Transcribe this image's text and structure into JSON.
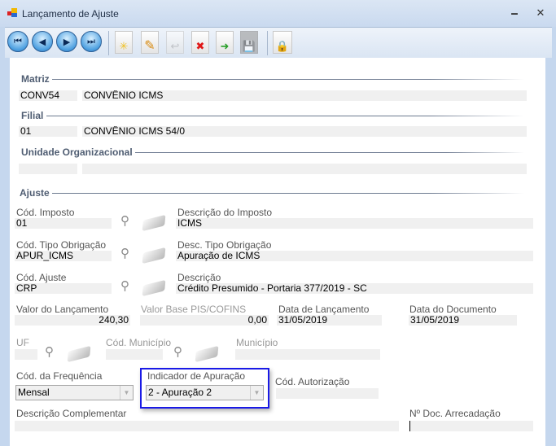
{
  "window": {
    "title": "Lançamento de Ajuste",
    "minimize": "🗕",
    "close": "✕"
  },
  "toolbar": {
    "first": "⏮",
    "prev": "◀",
    "next": "▶",
    "last": "⏭",
    "new": "✳",
    "edit": "✎",
    "undo": "↩",
    "delete": "✖",
    "export": "➜",
    "save": "💾",
    "lock": "🔒"
  },
  "matriz": {
    "heading": "Matriz",
    "code": "CONV54",
    "name": "CONVÊNIO ICMS"
  },
  "filial": {
    "heading": "Filial",
    "code": "01",
    "name": "CONVÊNIO ICMS 54/0"
  },
  "unidade": {
    "heading": "Unidade Organizacional",
    "code": "",
    "name": ""
  },
  "ajuste": {
    "heading": "Ajuste",
    "cod_imposto": {
      "label": "Cód. Imposto",
      "value": "01"
    },
    "desc_imposto": {
      "label": "Descrição do Imposto",
      "value": "ICMS"
    },
    "cod_tipo": {
      "label": "Cód. Tipo Obrigação",
      "value": "APUR_ICMS"
    },
    "desc_tipo": {
      "label": "Desc. Tipo Obrigação",
      "value": "Apuração de ICMS"
    },
    "cod_ajuste": {
      "label": "Cód. Ajuste",
      "value": "CRP"
    },
    "descricao": {
      "label": "Descrição",
      "value": "Crédito Presumido - Portaria 377/2019 - SC"
    },
    "valor": {
      "label": "Valor do Lançamento",
      "value": "240,30"
    },
    "valor_base": {
      "label": "Valor Base PIS/COFINS",
      "value": "0,00"
    },
    "data_lanc": {
      "label": "Data de Lançamento",
      "value": "31/05/2019"
    },
    "data_doc": {
      "label": "Data do Documento",
      "value": "31/05/2019"
    },
    "uf": {
      "label": "UF",
      "value": ""
    },
    "cod_mun": {
      "label": "Cód. Município",
      "value": ""
    },
    "municipio": {
      "label": "Município",
      "value": ""
    },
    "freq": {
      "label": "Cód. da Frequência",
      "value": "Mensal"
    },
    "indicador": {
      "label": "Indicador de Apuração",
      "value": "2 - Apuração 2"
    },
    "cod_aut": {
      "label": "Cód. Autorização",
      "value": ""
    },
    "desc_comp": {
      "label": "Descrição Complementar",
      "value": ""
    },
    "num_doc": {
      "label": "Nº Doc. Arrecadação",
      "value": ""
    }
  },
  "icons": {
    "search": "⚲"
  }
}
